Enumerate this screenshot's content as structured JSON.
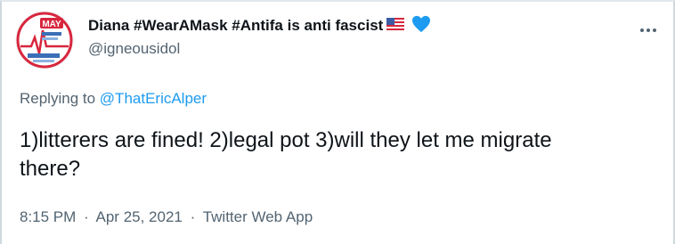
{
  "author": {
    "display_name": "Diana #WearAMask #Antifa is anti fascist",
    "handle": "@igneousidol",
    "avatar_icon": "avatar-logo-may-event",
    "badges": [
      "us-flag-icon",
      "blue-heart-icon"
    ]
  },
  "reply": {
    "prefix": "Replying to",
    "mention": "@ThatEricAlper"
  },
  "tweet": {
    "text_line1": "1)litterers are fined! 2)legal pot 3)will they let me migrate",
    "text_line2": "there?"
  },
  "meta": {
    "time": "8:15 PM",
    "separator": "·",
    "date": "Apr 25, 2021",
    "source": "Twitter Web App"
  },
  "colors": {
    "text_primary": "#0f1419",
    "text_secondary": "#536471",
    "link": "#1d9bf0",
    "heart": "#1d9bf0"
  },
  "more_icon": "more-dots-icon"
}
